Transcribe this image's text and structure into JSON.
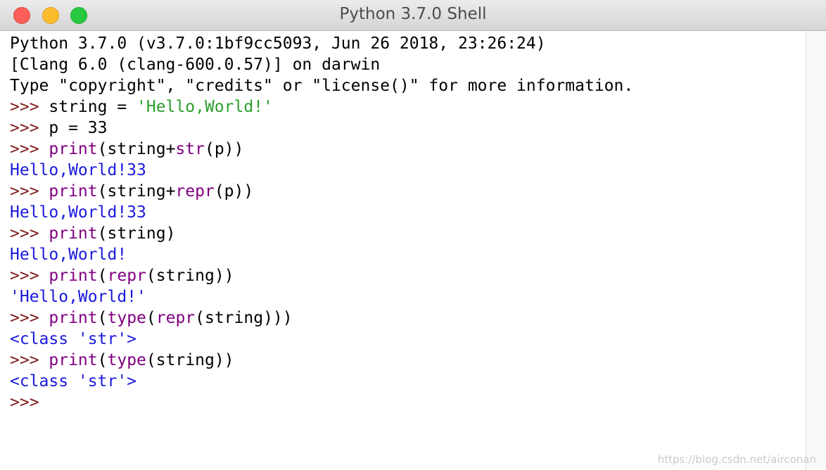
{
  "window": {
    "title": "Python 3.7.0 Shell"
  },
  "colors": {
    "prompt": "#7f1a1a",
    "builtin": "#800080",
    "string": "#2ca02c",
    "output": "#1a1adc",
    "default": "#000000"
  },
  "console": {
    "lines": [
      [
        {
          "text": "Python 3.7.0 (v3.7.0:1bf9cc5093, Jun 26 2018, 23:26:24)",
          "style": "default"
        }
      ],
      [
        {
          "text": "[Clang 6.0 (clang-600.0.57)] on darwin",
          "style": "default"
        }
      ],
      [
        {
          "text": "Type \"copyright\", \"credits\" or \"license()\" for more information.",
          "style": "default"
        }
      ],
      [
        {
          "text": ">>> ",
          "style": "prompt"
        },
        {
          "text": "string = ",
          "style": "default"
        },
        {
          "text": "'Hello,World!'",
          "style": "string"
        }
      ],
      [
        {
          "text": ">>> ",
          "style": "prompt"
        },
        {
          "text": "p = 33",
          "style": "default"
        }
      ],
      [
        {
          "text": ">>> ",
          "style": "prompt"
        },
        {
          "text": "print",
          "style": "builtin"
        },
        {
          "text": "(string+",
          "style": "default"
        },
        {
          "text": "str",
          "style": "builtin"
        },
        {
          "text": "(p))",
          "style": "default"
        }
      ],
      [
        {
          "text": "Hello,World!33",
          "style": "output"
        }
      ],
      [
        {
          "text": ">>> ",
          "style": "prompt"
        },
        {
          "text": "print",
          "style": "builtin"
        },
        {
          "text": "(string+",
          "style": "default"
        },
        {
          "text": "repr",
          "style": "builtin"
        },
        {
          "text": "(p))",
          "style": "default"
        }
      ],
      [
        {
          "text": "Hello,World!33",
          "style": "output"
        }
      ],
      [
        {
          "text": ">>> ",
          "style": "prompt"
        },
        {
          "text": "print",
          "style": "builtin"
        },
        {
          "text": "(string)",
          "style": "default"
        }
      ],
      [
        {
          "text": "Hello,World!",
          "style": "output"
        }
      ],
      [
        {
          "text": ">>> ",
          "style": "prompt"
        },
        {
          "text": "print",
          "style": "builtin"
        },
        {
          "text": "(",
          "style": "default"
        },
        {
          "text": "repr",
          "style": "builtin"
        },
        {
          "text": "(string))",
          "style": "default"
        }
      ],
      [
        {
          "text": "'Hello,World!'",
          "style": "output"
        }
      ],
      [
        {
          "text": ">>> ",
          "style": "prompt"
        },
        {
          "text": "print",
          "style": "builtin"
        },
        {
          "text": "(",
          "style": "default"
        },
        {
          "text": "type",
          "style": "builtin"
        },
        {
          "text": "(",
          "style": "default"
        },
        {
          "text": "repr",
          "style": "builtin"
        },
        {
          "text": "(string)))",
          "style": "default"
        }
      ],
      [
        {
          "text": "<class 'str'>",
          "style": "output"
        }
      ],
      [
        {
          "text": ">>> ",
          "style": "prompt"
        },
        {
          "text": "print",
          "style": "builtin"
        },
        {
          "text": "(",
          "style": "default"
        },
        {
          "text": "type",
          "style": "builtin"
        },
        {
          "text": "(string))",
          "style": "default"
        }
      ],
      [
        {
          "text": "<class 'str'>",
          "style": "output"
        }
      ],
      [
        {
          "text": ">>> ",
          "style": "prompt"
        }
      ]
    ]
  },
  "watermark": "https://blog.csdn.net/airconan"
}
